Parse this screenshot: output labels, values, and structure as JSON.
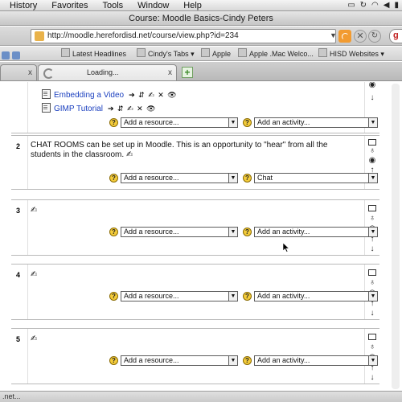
{
  "menubar": {
    "items": [
      "History",
      "Favorites",
      "Tools",
      "Window",
      "Help"
    ]
  },
  "window": {
    "title": "Course: Moodle Basics-Cindy Peters"
  },
  "navbar": {
    "url": "http://moodle.herefordisd.net/course/view.php?id=234",
    "search_glyph": "g"
  },
  "bookmarks": [
    "Latest Headlines",
    "Cindy's Tabs ▾",
    "Apple",
    "Apple .Mac Welco...",
    "HISD Websites ▾"
  ],
  "tabs": {
    "active_label": "Loading...",
    "close_glyph": "x",
    "new_tab_glyph": "+"
  },
  "course": {
    "edit_icons": "➔ ⇵ ✍ ✕ 👁",
    "help_glyph": "?",
    "resource_placeholder": "Add a resource...",
    "activity_placeholder": "Add an activity...",
    "resources": [
      {
        "label": "Embedding a Video"
      },
      {
        "label": "GIMP Tutorial"
      }
    ],
    "sections": [
      {
        "number": "2",
        "summary": "CHAT ROOMS can be set up in Moodle. This is an opportunity to \"hear\" from all the students in the classroom.",
        "activity_value": "Chat"
      },
      {
        "number": "3",
        "summary": "",
        "activity_value": "Add an activity..."
      },
      {
        "number": "4",
        "summary": "",
        "activity_value": "Add an activity..."
      },
      {
        "number": "5",
        "summary": "",
        "activity_value": "Add an activity..."
      }
    ]
  },
  "status": {
    "text": ".net..."
  }
}
